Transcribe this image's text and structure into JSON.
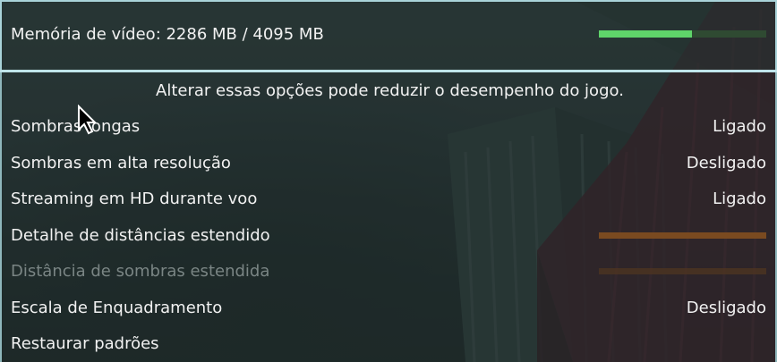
{
  "vram": {
    "label": "Memória de vídeo: 2286 MB / 4095 MB",
    "used_mb": 2286,
    "total_mb": 4095,
    "bar_color": "#5fd46a"
  },
  "warning": "Alterar essas opções pode reduzir o desempenho do jogo.",
  "settings": [
    {
      "label": "Sombras longas",
      "value": "Ligado"
    },
    {
      "label": "Sombras em alta resolução",
      "value": "Desligado"
    },
    {
      "label": "Streaming em HD durante voo",
      "value": "Ligado"
    },
    {
      "label": "Detalhe de distâncias estendido",
      "slider": true,
      "level": 0.0
    },
    {
      "label": "Distância de sombras estendida",
      "slider": true,
      "level": 0.0,
      "disabled": true
    },
    {
      "label": "Escala de Enquadramento",
      "value": "Desligado"
    }
  ],
  "restore_label": "Restaurar padrões",
  "icons": {
    "cursor": "mouse-pointer-icon"
  }
}
